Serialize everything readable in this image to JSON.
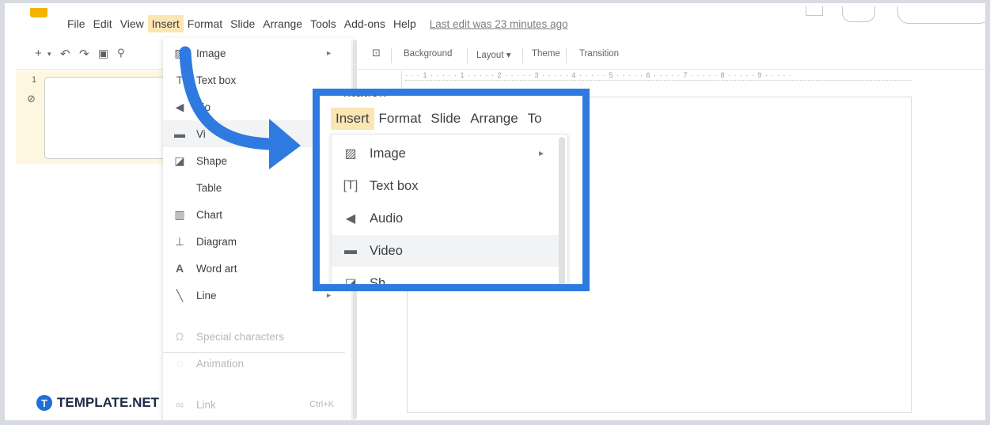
{
  "menubar": {
    "items": [
      "File",
      "Edit",
      "View",
      "Insert",
      "Format",
      "Slide",
      "Arrange",
      "Tools",
      "Add-ons",
      "Help"
    ],
    "active": "Insert",
    "last_edit": "Last edit was 23 minutes ago"
  },
  "toolbar": {
    "background_label": "Background",
    "layout_label": "Layout ▾",
    "theme_label": "Theme",
    "transition_label": "Transition"
  },
  "filmstrip": {
    "slide_number": "1"
  },
  "ruler": {
    "text": "· · · 1 · · · · · 1 · · · · · 2 · · · · · 3 · · · · · 4 · · · · · 5 · · · · · 6 · · · · · 7 · · · · · 8 · · · · · 9 · · · · ·"
  },
  "insert_menu": {
    "items": [
      {
        "label": "Image",
        "icon": "image-icon",
        "submenu": true
      },
      {
        "label": "Text box",
        "icon": "text-box-icon"
      },
      {
        "label": "dio",
        "icon": "audio-icon"
      },
      {
        "label": "Vi",
        "icon": "video-icon"
      },
      {
        "label": "Shape",
        "icon": "shape-icon"
      },
      {
        "label": "Table",
        "icon": ""
      },
      {
        "label": "Chart",
        "icon": "chart-icon"
      },
      {
        "label": "Diagram",
        "icon": "diagram-icon"
      },
      {
        "label": "Word art",
        "icon": "word-art-icon"
      },
      {
        "label": "Line",
        "icon": "line-icon",
        "submenu": true
      }
    ],
    "disabled_items": [
      {
        "label": "Special characters",
        "icon": "omega-icon"
      },
      {
        "label": "Animation",
        "icon": "animation-icon"
      }
    ],
    "link": {
      "label": "Link",
      "shortcut": "Ctrl+K"
    }
  },
  "zoom": {
    "title_fragment": "ntation",
    "menubar": [
      "Insert",
      "Format",
      "Slide",
      "Arrange",
      "To"
    ],
    "items": [
      {
        "label": "Image",
        "icon": "image-icon",
        "submenu": true
      },
      {
        "label": "Text box",
        "icon": "text-box-icon"
      },
      {
        "label": "Audio",
        "icon": "audio-icon"
      },
      {
        "label": "Video",
        "icon": "video-icon"
      },
      {
        "label": "Sh",
        "icon": "shape-icon"
      }
    ],
    "accent_color": "#2e7ae0"
  },
  "brand": {
    "name": "TEMPLATE.NET",
    "icon_letter": "T"
  }
}
